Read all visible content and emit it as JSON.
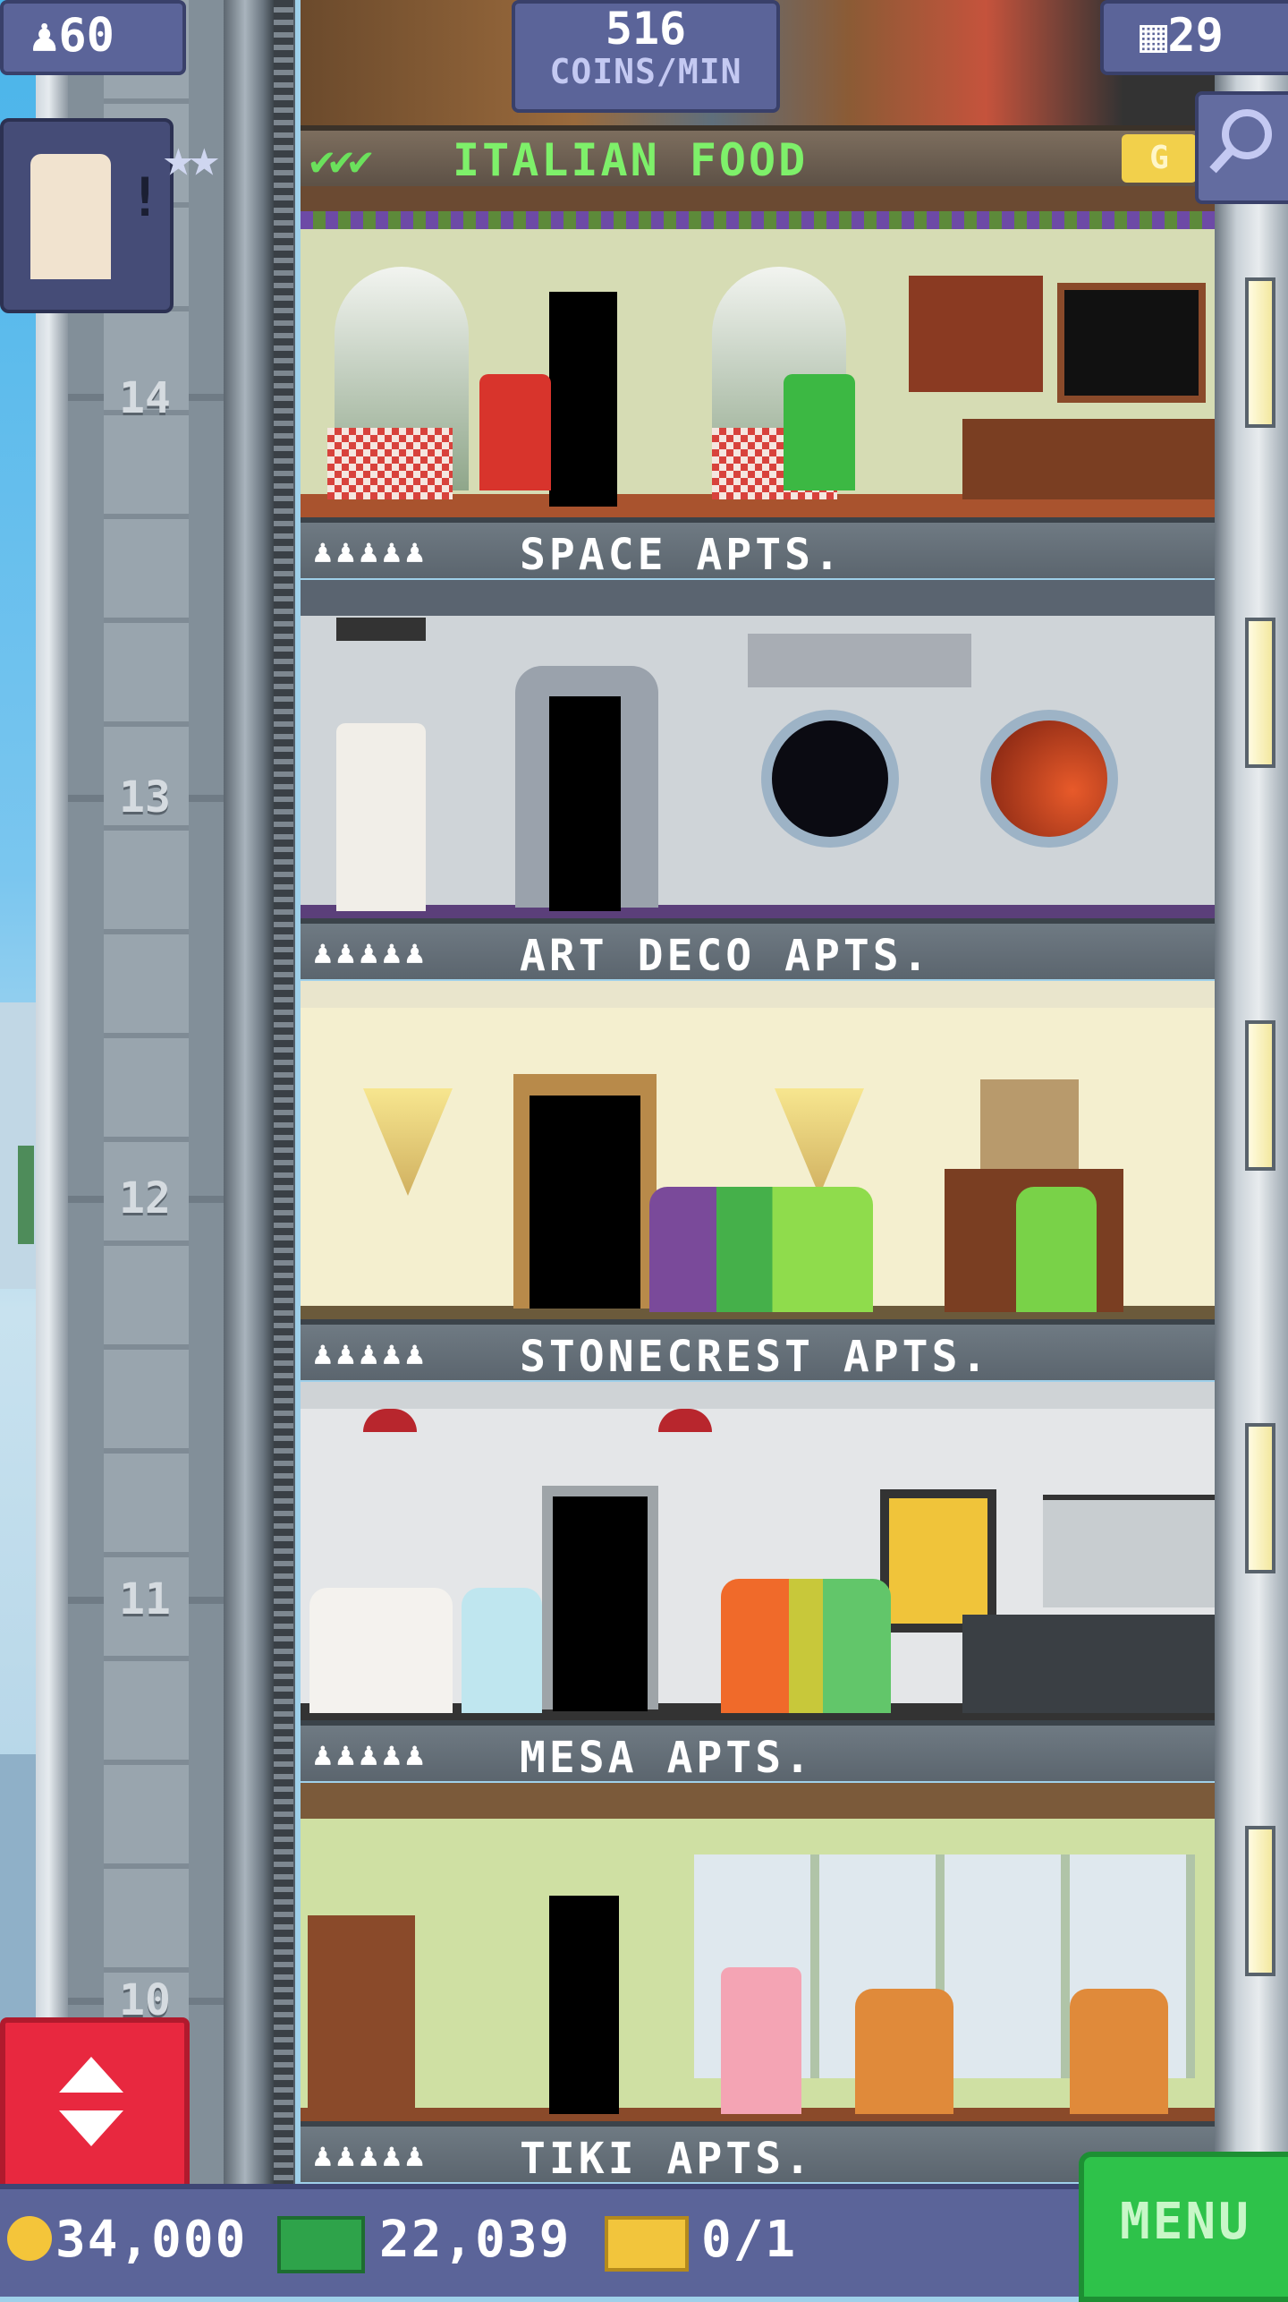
{
  "hud": {
    "population": "60",
    "coins_per_min_value": "516",
    "coins_per_min_label": "COINS/MIN",
    "floors": "29"
  },
  "top_shop": {
    "name": "ITALIAN FOOD",
    "badge": "G",
    "checks": "✔✔✔"
  },
  "floors": [
    {
      "number": "14",
      "label": "SPACE APTS.",
      "people": "♟♟♟♟♟"
    },
    {
      "number": "13",
      "label": "ART DECO APTS.",
      "people": "♟♟♟♟♟"
    },
    {
      "number": "12",
      "label": "STONECREST APTS.",
      "people": "♟♟♟♟♟"
    },
    {
      "number": "11",
      "label": "MESA APTS.",
      "people": "♟♟♟♟♟"
    },
    {
      "number": "10",
      "label": "TIKI APTS.",
      "people": "♟♟♟♟♟"
    }
  ],
  "bottom": {
    "coins": "34,000",
    "bux": "22,039",
    "tickets": "0/1",
    "menu_label": "MENU"
  },
  "colors": {
    "hud_blue": "#5b6499",
    "menu_green": "#2ec24a",
    "elevator_red": "#e8283f",
    "check_green": "#7ef06a"
  }
}
